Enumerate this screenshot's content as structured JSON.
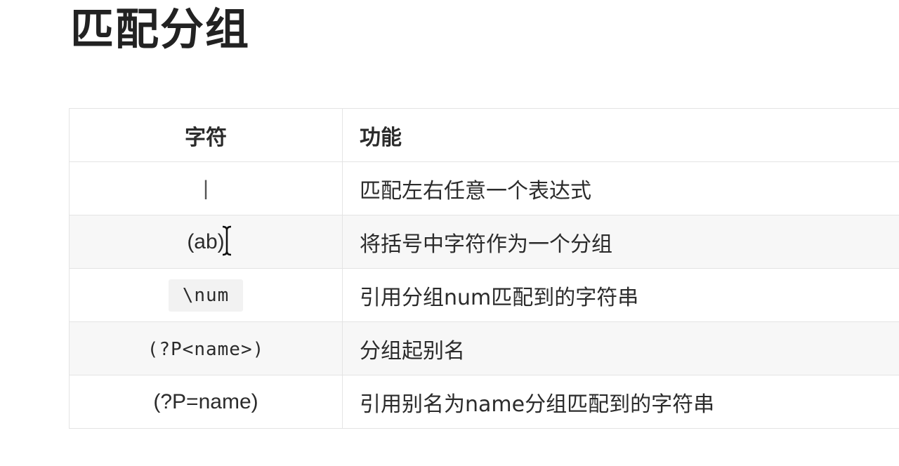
{
  "page": {
    "title": "匹配分组"
  },
  "table": {
    "headers": {
      "char": "字符",
      "func": "功能"
    },
    "rows": [
      {
        "char": "|",
        "func": "匹配左右任意一个表达式"
      },
      {
        "char": "(ab)",
        "func": "将括号中字符作为一个分组"
      },
      {
        "char": "\\num",
        "func": "引用分组num匹配到的字符串"
      },
      {
        "char": "(?P<name>)",
        "func": "分组起别名"
      },
      {
        "char": "(?P=name)",
        "func": "引用别名为name分组匹配到的字符串"
      }
    ]
  },
  "icons": {
    "cursor": "text-cursor-icon"
  }
}
